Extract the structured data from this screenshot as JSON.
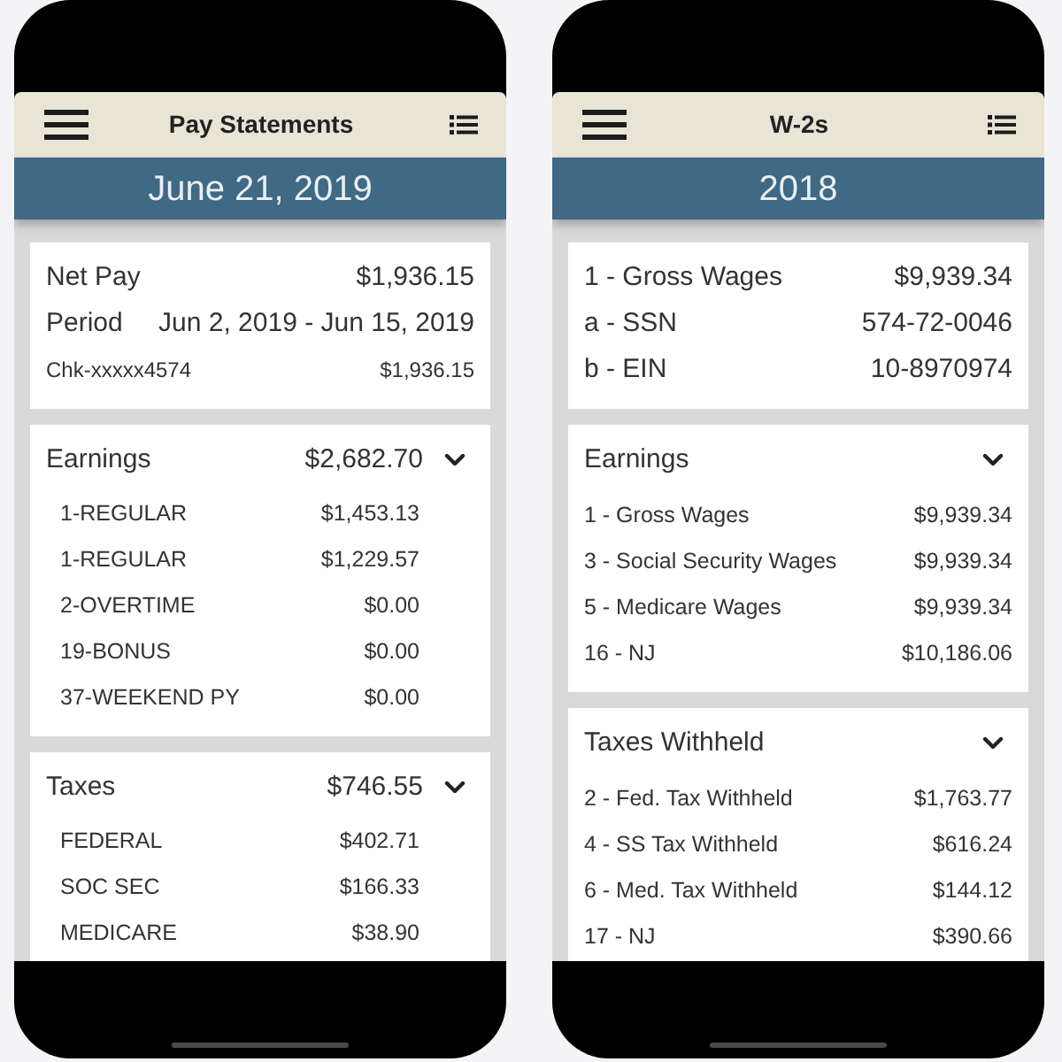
{
  "screens": [
    {
      "kind": "pay_statement",
      "title": "Pay Statements",
      "banner": "June 21, 2019",
      "summary": [
        {
          "kind": "main",
          "label": "Net Pay",
          "value": "$1,936.15"
        },
        {
          "kind": "main",
          "label": "Period",
          "value": "Jun 2, 2019 - Jun 15, 2019"
        },
        {
          "kind": "minor",
          "label": "Chk-xxxxx4574",
          "value": "$1,936.15"
        }
      ],
      "sections": [
        {
          "title": "Earnings",
          "total": "$2,682.70",
          "rows": [
            {
              "label": "1-REGULAR",
              "value": "$1,453.13"
            },
            {
              "label": "1-REGULAR",
              "value": "$1,229.57"
            },
            {
              "label": "2-OVERTIME",
              "value": "$0.00"
            },
            {
              "label": "19-BONUS",
              "value": "$0.00"
            },
            {
              "label": "37-WEEKEND PY",
              "value": "$0.00"
            }
          ]
        },
        {
          "title": "Taxes",
          "total": "$746.55",
          "rows": [
            {
              "label": "FEDERAL",
              "value": "$402.71"
            },
            {
              "label": "SOC SEC",
              "value": "$166.33"
            },
            {
              "label": "MEDICARE",
              "value": "$38.90"
            }
          ]
        }
      ]
    },
    {
      "kind": "w2",
      "title": "W-2s",
      "banner": "2018",
      "summary": [
        {
          "kind": "main",
          "label": "1 - Gross Wages",
          "value": "$9,939.34"
        },
        {
          "kind": "main",
          "label": "a - SSN",
          "value": "574-72-0046"
        },
        {
          "kind": "main",
          "label": "b - EIN",
          "value": "10-8970974"
        }
      ],
      "sections": [
        {
          "title": "Earnings",
          "rows": [
            {
              "label": "1 - Gross Wages",
              "value": "$9,939.34"
            },
            {
              "label": "3 - Social Security Wages",
              "value": "$9,939.34"
            },
            {
              "label": "5 - Medicare Wages",
              "value": "$9,939.34"
            },
            {
              "label": "16 - NJ",
              "value": "$10,186.06"
            }
          ]
        },
        {
          "title": "Taxes Withheld",
          "rows": [
            {
              "label": "2 - Fed. Tax Withheld",
              "value": "$1,763.77"
            },
            {
              "label": "4 - SS Tax Withheld",
              "value": "$616.24"
            },
            {
              "label": "6 - Med. Tax Withheld",
              "value": "$144.12"
            },
            {
              "label": "17 - NJ",
              "value": "$390.66"
            }
          ]
        }
      ]
    }
  ]
}
